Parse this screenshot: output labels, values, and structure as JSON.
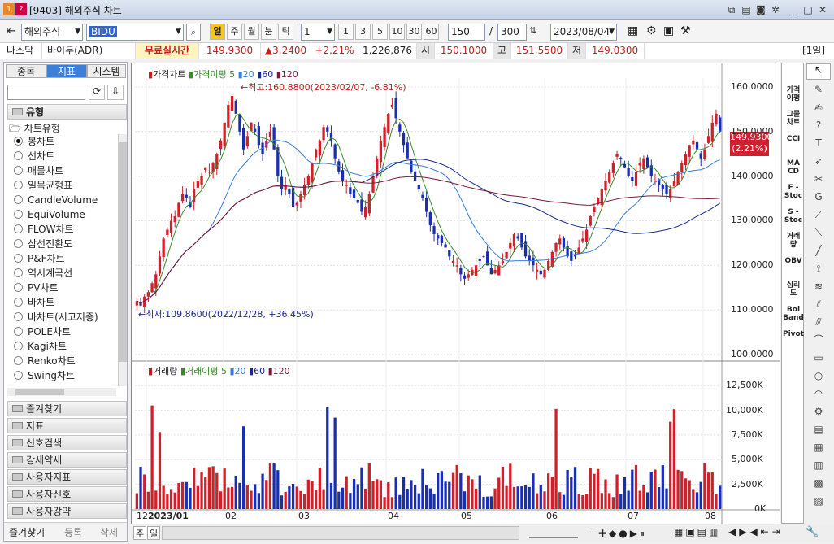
{
  "window": {
    "badge": "1",
    "code": "[9403]",
    "title": "해외주식 차트"
  },
  "toolbar": {
    "market": "해외주식",
    "symbol": "BIDU",
    "periods": [
      "일",
      "주",
      "월",
      "분",
      "틱"
    ],
    "interval": "1",
    "presets": [
      "1",
      "3",
      "5",
      "10",
      "30",
      "60"
    ],
    "count": "150",
    "total": "300",
    "date": "2023/08/04"
  },
  "quote": {
    "exchange": "나스닥",
    "name": "바이두(ADR)",
    "realtime": "무료실시간",
    "price": "149.9300",
    "change": "▲3.2400",
    "pct": "+2.21%",
    "volume": "1,226,876",
    "open_label": "시",
    "open": "150.1000",
    "high_label": "고",
    "high": "151.5500",
    "low_label": "저",
    "low": "149.0300",
    "period_tag": "[1일]"
  },
  "left": {
    "tabs": [
      "종목",
      "지표",
      "시스템"
    ],
    "section": "유형",
    "tree_head": "차트유형",
    "items": [
      "봉차트",
      "선차트",
      "매물차트",
      "일목균형표",
      "CandleVolume",
      "EquiVolume",
      "FLOW차트",
      "삼선전환도",
      "P&F차트",
      "역시계곡선",
      "PV차트",
      "바차트",
      "바차트(시고저종)",
      "POLE차트",
      "Kagi차트",
      "Renko차트",
      "Swing차트"
    ],
    "sections": [
      "즐겨찾기",
      "지표",
      "신호검색",
      "강세약세",
      "사용자지표",
      "사용자신호",
      "사용자강약"
    ],
    "bottom_tabs": [
      "즐겨찾기",
      "등록",
      "삭제"
    ]
  },
  "chart": {
    "price_label": "가격차트",
    "ma_label": "가격이평",
    "ma_periods": [
      "5",
      "20",
      "60",
      "120"
    ],
    "vol_label": "거래량",
    "vma_label": "거래이평",
    "high_note": "←최고:160.8800(2023/02/07, -6.81%)",
    "low_note": "←최저:109.8600(2022/12/28, +36.45%)",
    "cur_price": "149.9300",
    "cur_pct": "(2.21%)",
    "price_ticks": [
      "160.0000",
      "150.0000",
      "140.0000",
      "130.0000",
      "120.0000",
      "110.0000",
      "100.0000"
    ],
    "vol_ticks": [
      "12,500K",
      "10,000K",
      "7,500K",
      "5,000K",
      "2,500K",
      "0K"
    ],
    "x_labels": [
      "12",
      "2023/01",
      "02",
      "03",
      "04",
      "05",
      "06",
      "07",
      "08"
    ]
  },
  "right": {
    "labels": [
      "가격\n이평",
      "그물\n차트",
      "CCI",
      "MA\nCD",
      "F -\nStoc",
      "S -\nStoc",
      "거래\n량",
      "OBV",
      "심리\n도",
      "Bol\nBand",
      "Pivot"
    ]
  },
  "bottom": {
    "mode": "주",
    "view": "일"
  },
  "chart_data": {
    "type": "candlestick",
    "y_range": [
      100,
      162
    ],
    "vol_range_k": [
      0,
      14000
    ],
    "closes": [
      112,
      111,
      113,
      114,
      116,
      118,
      122,
      126,
      128,
      130,
      131,
      134,
      136,
      135,
      133,
      137,
      139,
      140,
      142,
      141,
      143,
      145,
      148,
      152,
      156,
      158,
      154,
      150,
      146,
      149,
      152,
      150,
      147,
      145,
      148,
      150,
      146,
      140,
      137,
      138,
      136,
      133,
      134,
      136,
      138,
      140,
      143,
      146,
      148,
      151,
      150,
      148,
      144,
      141,
      139,
      138,
      136,
      135,
      134,
      132,
      133,
      136,
      140,
      144,
      148,
      151,
      154,
      156,
      153,
      150,
      147,
      144,
      141,
      139,
      137,
      135,
      132,
      129,
      127,
      126,
      125,
      124,
      122,
      121,
      120,
      118,
      117,
      118,
      119,
      120,
      121,
      122,
      120,
      118,
      119,
      120,
      121,
      123,
      125,
      127,
      126,
      124,
      122,
      121,
      120,
      119,
      118,
      119,
      121,
      123,
      125,
      126,
      124,
      122,
      121,
      122,
      124,
      126,
      128,
      131,
      133,
      135,
      137,
      139,
      141,
      143,
      145,
      144,
      142,
      140,
      139,
      141,
      143,
      144,
      142,
      140,
      139,
      138,
      137,
      136,
      137,
      139,
      141,
      143,
      145,
      147,
      148,
      146,
      144,
      146,
      149,
      152,
      154,
      150
    ]
  }
}
